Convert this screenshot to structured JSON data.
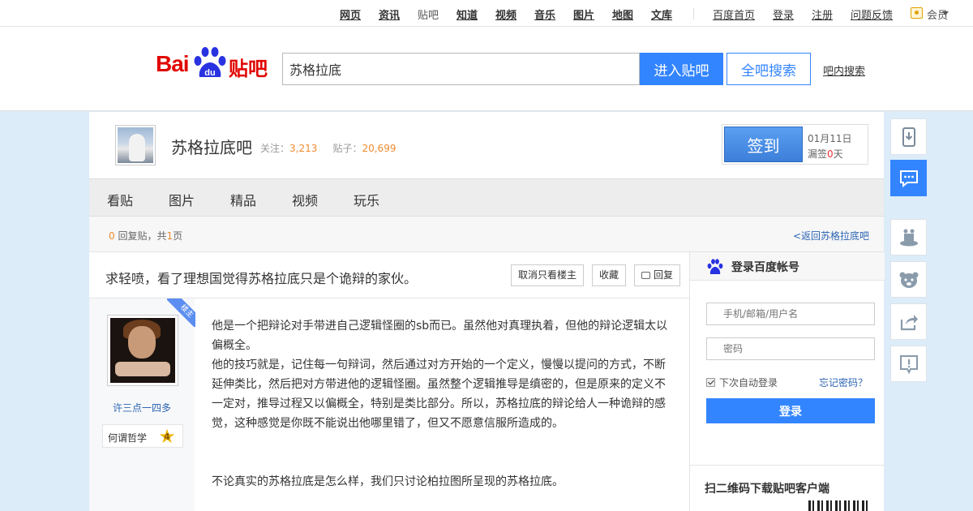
{
  "topnav": {
    "items": [
      {
        "label": "网页",
        "style": "bold"
      },
      {
        "label": "资讯",
        "style": "bold"
      },
      {
        "label": "贴吧",
        "style": "plain"
      },
      {
        "label": "知道",
        "style": "bold"
      },
      {
        "label": "视频",
        "style": "bold"
      },
      {
        "label": "音乐",
        "style": "bold"
      },
      {
        "label": "图片",
        "style": "bold"
      },
      {
        "label": "地图",
        "style": "bold"
      },
      {
        "label": "文库",
        "style": "bold"
      }
    ],
    "right": {
      "home": "百度首页",
      "login": "登录",
      "register": "注册",
      "feedback": "问题反馈",
      "member": "会员"
    }
  },
  "header": {
    "logo": {
      "bai": "Bai",
      "du": "du",
      "tieba": "贴吧"
    },
    "search_value": "苏格拉底",
    "enter_label": "进入贴吧",
    "all_label": "全吧搜索",
    "inner_label": "吧内搜索"
  },
  "forum": {
    "name": "苏格拉底吧",
    "follow_label": "关注：",
    "follow_count": "3,213",
    "posts_label": "贴子：",
    "posts_count": "20,699",
    "sign_label": "签到",
    "sign_date": "01月11日",
    "miss_prefix": "漏签",
    "miss_days": "0",
    "miss_suffix": "天",
    "tabs": [
      "看贴",
      "图片",
      "精品",
      "视频",
      "玩乐"
    ]
  },
  "reply_bar": {
    "reply_count": "0",
    "reply_mid": "回复贴，共",
    "page_count": "1",
    "page_suffix": "页",
    "back_link": "<返回苏格拉底吧"
  },
  "post": {
    "title": "求轻喷，看了理想国觉得苏格拉底只是个诡辩的家伙。",
    "btn_only_owner": "取消只看楼主",
    "btn_fav": "收藏",
    "btn_reply": "回复",
    "owner_badge": "楼主",
    "author_name": "许三点一四多",
    "level_name": "何谓哲学",
    "level_num": "4",
    "paragraph1": "他是一个把辩论对手带进自己逻辑怪圈的sb而已。虽然他对真理执着，但他的辩论逻辑太以偏概全。",
    "paragraph2": "他的技巧就是，记住每一句辩词，然后通过对方开始的一个定义，慢慢以提问的方式，不断延伸类比，然后把对方带进他的逻辑怪圈。虽然整个逻辑推导是缜密的，但是原来的定义不一定对，推导过程又以偏概全，特别是类比部分。所以，苏格拉底的辩论给人一种诡辩的感觉，这种感觉是你既不能说出他哪里错了，但又不愿意信服所造成的。",
    "paragraph3": "不论真实的苏格拉底是怎么样，我们只讨论柏拉图所呈现的苏格拉底。"
  },
  "sidebar": {
    "login_title": "登录百度帐号",
    "username_placeholder": "手机/邮箱/用户名",
    "password_placeholder": "密码",
    "auto_login": "下次自动登录",
    "forgot": "忘记密码？",
    "login_btn": "登录",
    "qr_title": "扫二维码下载贴吧客户端"
  },
  "colors": {
    "accent": "#3385ff",
    "brand_red": "#e10601",
    "count_orange": "#f08b2f",
    "link_blue": "#2d64b3",
    "page_bg": "#dcecf9"
  },
  "tools": [
    "download-icon",
    "chat-icon",
    "magic-hat-icon",
    "bear-icon",
    "share-icon",
    "report-icon"
  ]
}
